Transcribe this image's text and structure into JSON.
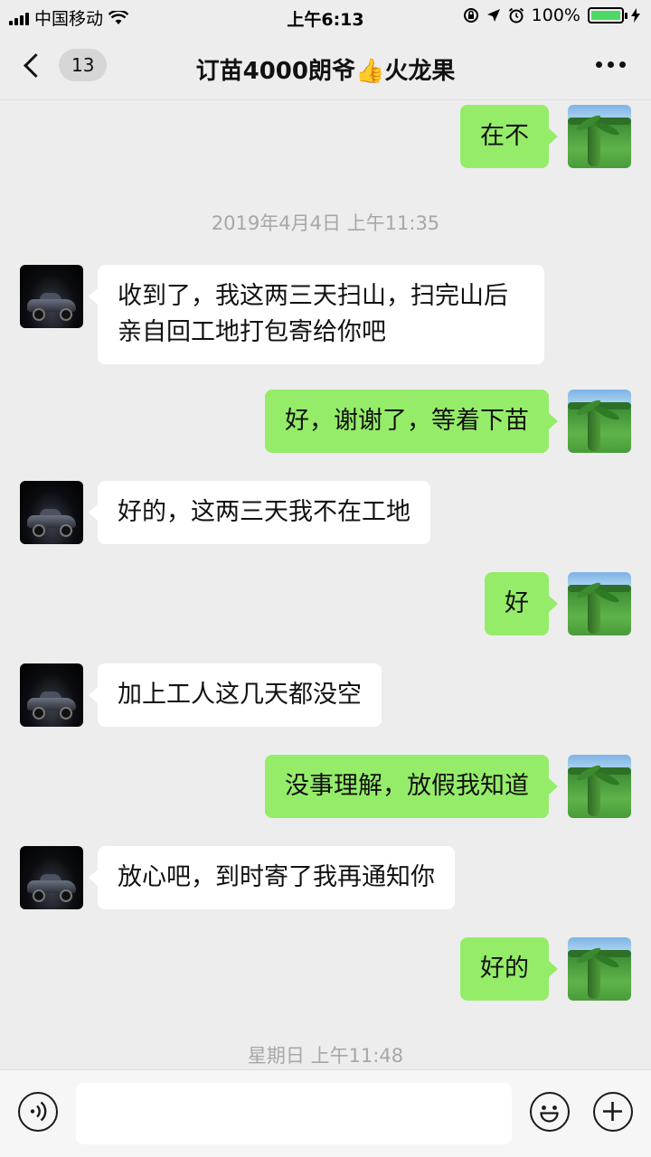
{
  "status_bar": {
    "carrier": "中国移动",
    "time": "上午6:13",
    "battery": "100%"
  },
  "nav": {
    "unread_count": "13",
    "title": "订苗4000朗爷👍火龙果"
  },
  "messages": [
    {
      "type": "message",
      "side": "out",
      "text": "在不"
    },
    {
      "type": "timestamp",
      "text": "2019年4月4日 上午11:35"
    },
    {
      "type": "message",
      "side": "in",
      "text": "收到了，我这两三天扫山，扫完山后亲自回工地打包寄给你吧"
    },
    {
      "type": "message",
      "side": "out",
      "text": "好，谢谢了，等着下苗"
    },
    {
      "type": "message",
      "side": "in",
      "text": "好的，这两三天我不在工地"
    },
    {
      "type": "message",
      "side": "out",
      "text": "好"
    },
    {
      "type": "message",
      "side": "in",
      "text": "加上工人这几天都没空"
    },
    {
      "type": "message",
      "side": "out",
      "text": "没事理解，放假我知道"
    },
    {
      "type": "message",
      "side": "in",
      "text": "放心吧，到时寄了我再通知你"
    },
    {
      "type": "message",
      "side": "out",
      "text": "好的"
    },
    {
      "type": "timestamp",
      "text": "星期日 上午11:48"
    }
  ],
  "input": {
    "placeholder": ""
  },
  "colors": {
    "outgoing_bubble": "#95ec69",
    "incoming_bubble": "#ffffff",
    "background": "#ededed"
  },
  "icons": {
    "voice": "voice-icon",
    "emoji": "emoji-icon",
    "plus": "plus-icon",
    "back": "chevron-left-icon",
    "more": "more-icon"
  }
}
